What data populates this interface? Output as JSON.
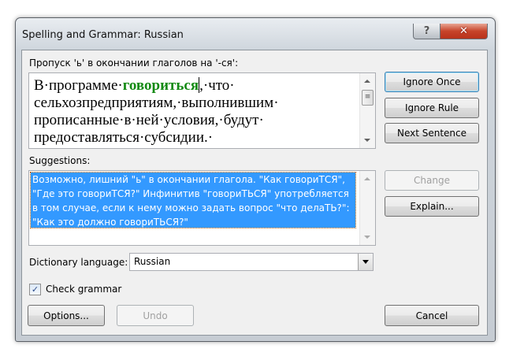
{
  "window": {
    "title": "Spelling and Grammar: Russian",
    "help_label": "?",
    "close_label": "✕"
  },
  "error_label": "Пропуск 'ь' в окончании глаголов на '-ся':",
  "sentence": {
    "before": "В·программе·",
    "error_word": "говориться",
    "after": ",·что·\nсельхозпредприятиям,·выполнившим·\nпрописанные·в·ней·условия,·будут·\nпредоставляться·субсидии.·"
  },
  "suggestions_label": "Suggestions:",
  "suggestion_text": "Возможно, лишний \"ь\" в окончании глагола. \"Как говориТСЯ\", \"Где это говориТСЯ?\" Инфинитив \"говориТЬСЯ\" употребляется в том случае, если к нему можно задать вопрос \"что делаТЬ?\": \"Как это должно говориТЬСЯ?\"",
  "buttons": {
    "ignore_once": "Ignore Once",
    "ignore_rule": "Ignore Rule",
    "next_sentence": "Next Sentence",
    "change": "Change",
    "explain": "Explain...",
    "options": "Options...",
    "undo": "Undo",
    "cancel": "Cancel"
  },
  "dictionary": {
    "label": "Dictionary language:",
    "value": "Russian"
  },
  "check_grammar": {
    "label": "Check grammar",
    "checked": true
  },
  "colors": {
    "accent": "#3399ff",
    "error_word": "#138a13"
  }
}
